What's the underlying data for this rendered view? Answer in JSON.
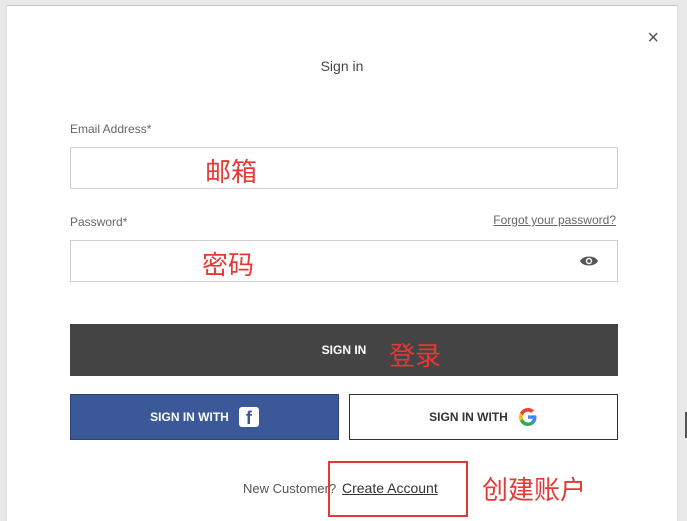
{
  "dialog": {
    "title": "Sign in",
    "close_glyph": "×"
  },
  "email": {
    "label": "Email Address*",
    "value": "",
    "annotation": "邮箱"
  },
  "password": {
    "label": "Password*",
    "forgot_link": "Forgot your password?",
    "value": "",
    "annotation": "密码",
    "toggle_icon": "eye-icon"
  },
  "signin_button": {
    "label": "SIGN IN",
    "annotation": "登录",
    "color": "#444444"
  },
  "social": {
    "facebook": {
      "label": "SIGN IN WITH",
      "icon": "facebook-icon",
      "color": "#3b5998"
    },
    "google": {
      "label": "SIGN IN WITH",
      "icon": "google-icon"
    }
  },
  "footer": {
    "prompt": "New Customer?",
    "create_link": "Create Account",
    "annotation": "创建账户"
  }
}
